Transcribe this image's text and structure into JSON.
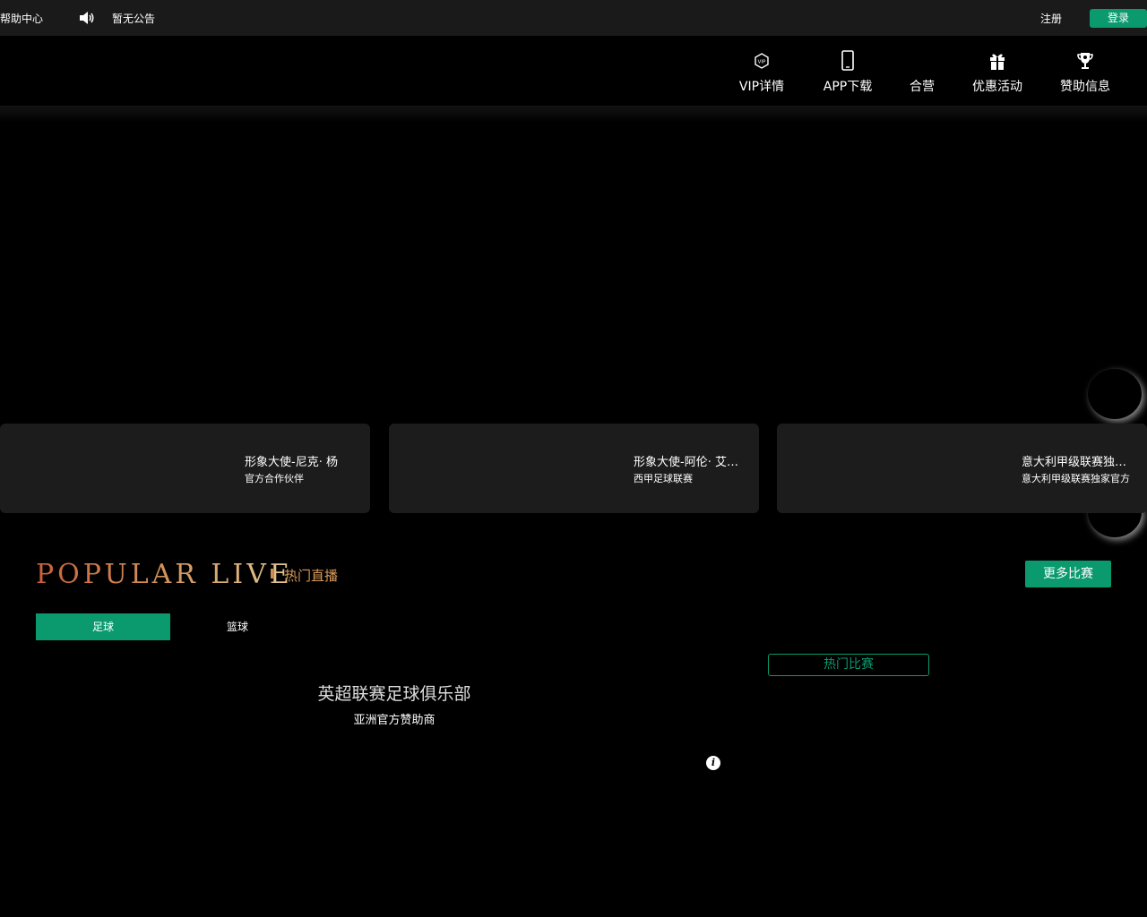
{
  "topbar": {
    "help": "帮助中心",
    "notice": "暂无公告",
    "register": "注册",
    "login": "登录"
  },
  "nav": {
    "items": [
      {
        "label": "VIP详情",
        "icon": "vip-icon"
      },
      {
        "label": "APP下载",
        "icon": "phone-icon"
      },
      {
        "label": "合营",
        "icon": ""
      },
      {
        "label": "优惠活动",
        "icon": "gift-icon"
      },
      {
        "label": "赞助信息",
        "icon": "trophy-icon"
      }
    ]
  },
  "cards": [
    {
      "title": "形象大使-尼克· 杨",
      "sub": "官方合作伙伴"
    },
    {
      "title": "形象大使-阿伦· 艾弗森",
      "sub": "西甲足球联赛"
    },
    {
      "title": "意大利甲级联赛独家亚洲官方",
      "sub": "意大利甲级联赛独家官方"
    }
  ],
  "popular": {
    "title_en": "POPULAR LIVE",
    "title_cn": "热门直播",
    "more": "更多比赛",
    "tabs": [
      "足球",
      "篮球"
    ],
    "hot": "热门比赛",
    "club_title": "英超联赛足球俱乐部",
    "club_sub": "亚洲官方赞助商"
  },
  "colors": {
    "accent": "#0a9a6e",
    "gold": "#d89a5a"
  }
}
